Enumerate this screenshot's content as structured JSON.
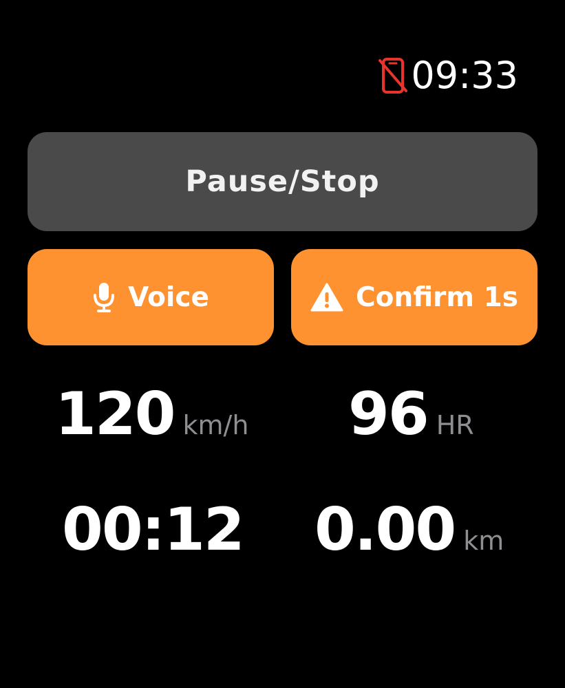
{
  "status_bar": {
    "time": "09:33",
    "phone_icon": "phone-disconnected-icon",
    "phone_icon_color": "#e8342c"
  },
  "controls": {
    "pause_stop_label": "Pause/Stop",
    "voice_label": "Voice",
    "voice_icon": "microphone-icon",
    "confirm_label": "Confirm 1s",
    "confirm_icon": "warning-icon"
  },
  "metrics": {
    "speed": {
      "value": "120",
      "unit": "km/h"
    },
    "heart_rate": {
      "value": "96",
      "unit": "HR"
    },
    "elapsed": {
      "value": "00:12"
    },
    "distance": {
      "value": "0.00",
      "unit": "km"
    }
  },
  "colors": {
    "background": "#000000",
    "pause_button": "#4a4a4a",
    "accent_orange": "#fe9130",
    "unit_gray": "#8e8e93",
    "alert_red": "#e8342c"
  }
}
